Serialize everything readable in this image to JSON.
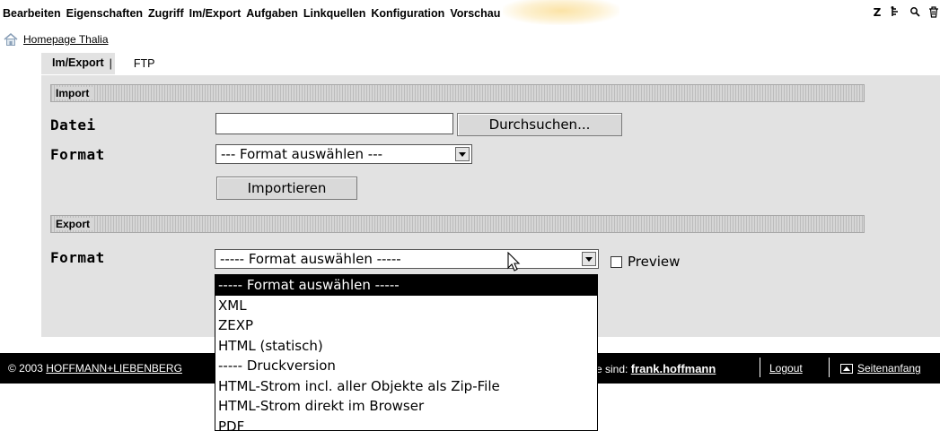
{
  "top_tabs": [
    "Bearbeiten",
    "Eigenschaften",
    "Zugriff",
    "Im/Export",
    "Aufgaben",
    "Linkquellen",
    "Konfiguration",
    "Vorschau"
  ],
  "toolbar_icons": [
    "zope-icon",
    "tree-icon",
    "search-icon",
    "trash-icon"
  ],
  "breadcrumb": {
    "label": "Homepage Thalia",
    "icon": "home-icon"
  },
  "sub_tabs": {
    "active": "Im/Export",
    "separator": "|",
    "other": "FTP"
  },
  "import_section": {
    "title": "Import",
    "file_label": "Datei",
    "file_value": "",
    "browse_button": "Durchsuchen...",
    "format_label": "Format",
    "format_selected": "--- Format auswählen ---",
    "import_button": "Importieren"
  },
  "export_section": {
    "title": "Export",
    "format_label": "Format",
    "format_selected": "----- Format auswählen -----",
    "preview_label": "Preview",
    "preview_checked": false,
    "options": [
      "----- Format auswählen -----",
      "XML",
      "ZEXP",
      "HTML (statisch)",
      "----- Druckversion",
      "HTML-Strom incl. aller Objekte als Zip-File",
      "HTML-Strom direkt im Browser",
      "PDF"
    ]
  },
  "footer": {
    "copyright_prefix": "© 2003",
    "company_link": "HOFFMANN+LIEBENBERG",
    "user_prefix": "e sind:",
    "username": "frank.hoffmann",
    "logout": "Logout",
    "to_top": "Seitenanfang"
  }
}
